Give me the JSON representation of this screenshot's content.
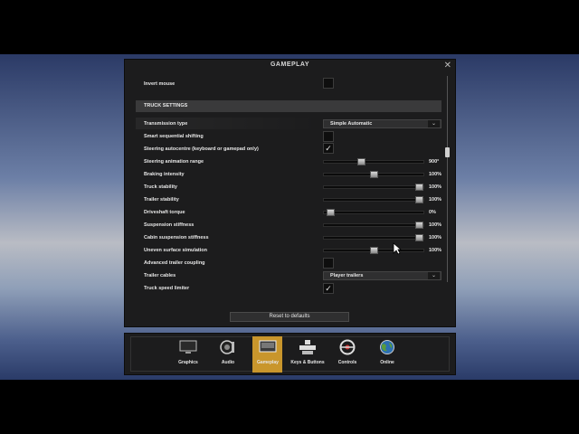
{
  "window": {
    "title": "GAMEPLAY",
    "close_glyph": "✕"
  },
  "settings": {
    "invert_mouse": {
      "label": "Invert mouse",
      "checked": false
    },
    "section_title": "TRUCK SETTINGS",
    "transmission": {
      "label": "Transmission type",
      "value": "Simple Automatic"
    },
    "smart_shifting": {
      "label": "Smart sequential shifting",
      "checked": false
    },
    "steering_autocentre": {
      "label": "Steering autocentre (keyboard or gamepad only)",
      "checked": true
    },
    "steering_animation": {
      "label": "Steering animation range",
      "value": "900°",
      "level": 0.37
    },
    "braking": {
      "label": "Braking intensity",
      "value": "100%",
      "level": 0.5
    },
    "truck_stability": {
      "label": "Truck stability",
      "value": "100%",
      "level": 0.95
    },
    "trailer_stability": {
      "label": "Trailer stability",
      "value": "100%",
      "level": 0.95
    },
    "driveshaft": {
      "label": "Driveshaft torque",
      "value": "0%",
      "level": 0.06
    },
    "suspension": {
      "label": "Suspension stiffness",
      "value": "100%",
      "level": 0.95
    },
    "cabin_suspension": {
      "label": "Cabin suspension stiffness",
      "value": "100%",
      "level": 0.95
    },
    "uneven_surface": {
      "label": "Uneven surface simulation",
      "value": "100%",
      "level": 0.5
    },
    "advanced_coupling": {
      "label": "Advanced trailer coupling",
      "checked": false
    },
    "trailer_cables": {
      "label": "Trailer cables",
      "value": "Player trailers"
    },
    "speed_limiter": {
      "label": "Truck speed limiter",
      "checked": true
    }
  },
  "reset_label": "Reset to defaults",
  "tabs": [
    {
      "label": "Graphics",
      "icon": "monitor-icon"
    },
    {
      "label": "Audio",
      "icon": "audio-icon"
    },
    {
      "label": "Gameplay",
      "icon": "gameplay-icon",
      "active": true
    },
    {
      "label": "Keys & Buttons",
      "icon": "keys-icon"
    },
    {
      "label": "Controls",
      "icon": "steering-wheel-icon"
    },
    {
      "label": "Online",
      "icon": "globe-icon"
    }
  ],
  "colors": {
    "accent": "#c9962c",
    "panel": "#1c1c1d"
  }
}
